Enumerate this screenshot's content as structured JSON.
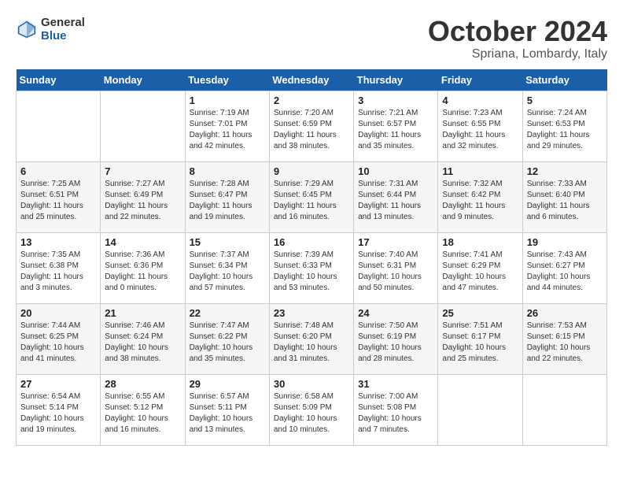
{
  "header": {
    "logo_general": "General",
    "logo_blue": "Blue",
    "month": "October 2024",
    "location": "Spriana, Lombardy, Italy"
  },
  "weekdays": [
    "Sunday",
    "Monday",
    "Tuesday",
    "Wednesday",
    "Thursday",
    "Friday",
    "Saturday"
  ],
  "weeks": [
    [
      {
        "day": "",
        "detail": ""
      },
      {
        "day": "",
        "detail": ""
      },
      {
        "day": "1",
        "detail": "Sunrise: 7:19 AM\nSunset: 7:01 PM\nDaylight: 11 hours and 42 minutes."
      },
      {
        "day": "2",
        "detail": "Sunrise: 7:20 AM\nSunset: 6:59 PM\nDaylight: 11 hours and 38 minutes."
      },
      {
        "day": "3",
        "detail": "Sunrise: 7:21 AM\nSunset: 6:57 PM\nDaylight: 11 hours and 35 minutes."
      },
      {
        "day": "4",
        "detail": "Sunrise: 7:23 AM\nSunset: 6:55 PM\nDaylight: 11 hours and 32 minutes."
      },
      {
        "day": "5",
        "detail": "Sunrise: 7:24 AM\nSunset: 6:53 PM\nDaylight: 11 hours and 29 minutes."
      }
    ],
    [
      {
        "day": "6",
        "detail": "Sunrise: 7:25 AM\nSunset: 6:51 PM\nDaylight: 11 hours and 25 minutes."
      },
      {
        "day": "7",
        "detail": "Sunrise: 7:27 AM\nSunset: 6:49 PM\nDaylight: 11 hours and 22 minutes."
      },
      {
        "day": "8",
        "detail": "Sunrise: 7:28 AM\nSunset: 6:47 PM\nDaylight: 11 hours and 19 minutes."
      },
      {
        "day": "9",
        "detail": "Sunrise: 7:29 AM\nSunset: 6:45 PM\nDaylight: 11 hours and 16 minutes."
      },
      {
        "day": "10",
        "detail": "Sunrise: 7:31 AM\nSunset: 6:44 PM\nDaylight: 11 hours and 13 minutes."
      },
      {
        "day": "11",
        "detail": "Sunrise: 7:32 AM\nSunset: 6:42 PM\nDaylight: 11 hours and 9 minutes."
      },
      {
        "day": "12",
        "detail": "Sunrise: 7:33 AM\nSunset: 6:40 PM\nDaylight: 11 hours and 6 minutes."
      }
    ],
    [
      {
        "day": "13",
        "detail": "Sunrise: 7:35 AM\nSunset: 6:38 PM\nDaylight: 11 hours and 3 minutes."
      },
      {
        "day": "14",
        "detail": "Sunrise: 7:36 AM\nSunset: 6:36 PM\nDaylight: 11 hours and 0 minutes."
      },
      {
        "day": "15",
        "detail": "Sunrise: 7:37 AM\nSunset: 6:34 PM\nDaylight: 10 hours and 57 minutes."
      },
      {
        "day": "16",
        "detail": "Sunrise: 7:39 AM\nSunset: 6:33 PM\nDaylight: 10 hours and 53 minutes."
      },
      {
        "day": "17",
        "detail": "Sunrise: 7:40 AM\nSunset: 6:31 PM\nDaylight: 10 hours and 50 minutes."
      },
      {
        "day": "18",
        "detail": "Sunrise: 7:41 AM\nSunset: 6:29 PM\nDaylight: 10 hours and 47 minutes."
      },
      {
        "day": "19",
        "detail": "Sunrise: 7:43 AM\nSunset: 6:27 PM\nDaylight: 10 hours and 44 minutes."
      }
    ],
    [
      {
        "day": "20",
        "detail": "Sunrise: 7:44 AM\nSunset: 6:25 PM\nDaylight: 10 hours and 41 minutes."
      },
      {
        "day": "21",
        "detail": "Sunrise: 7:46 AM\nSunset: 6:24 PM\nDaylight: 10 hours and 38 minutes."
      },
      {
        "day": "22",
        "detail": "Sunrise: 7:47 AM\nSunset: 6:22 PM\nDaylight: 10 hours and 35 minutes."
      },
      {
        "day": "23",
        "detail": "Sunrise: 7:48 AM\nSunset: 6:20 PM\nDaylight: 10 hours and 31 minutes."
      },
      {
        "day": "24",
        "detail": "Sunrise: 7:50 AM\nSunset: 6:19 PM\nDaylight: 10 hours and 28 minutes."
      },
      {
        "day": "25",
        "detail": "Sunrise: 7:51 AM\nSunset: 6:17 PM\nDaylight: 10 hours and 25 minutes."
      },
      {
        "day": "26",
        "detail": "Sunrise: 7:53 AM\nSunset: 6:15 PM\nDaylight: 10 hours and 22 minutes."
      }
    ],
    [
      {
        "day": "27",
        "detail": "Sunrise: 6:54 AM\nSunset: 5:14 PM\nDaylight: 10 hours and 19 minutes."
      },
      {
        "day": "28",
        "detail": "Sunrise: 6:55 AM\nSunset: 5:12 PM\nDaylight: 10 hours and 16 minutes."
      },
      {
        "day": "29",
        "detail": "Sunrise: 6:57 AM\nSunset: 5:11 PM\nDaylight: 10 hours and 13 minutes."
      },
      {
        "day": "30",
        "detail": "Sunrise: 6:58 AM\nSunset: 5:09 PM\nDaylight: 10 hours and 10 minutes."
      },
      {
        "day": "31",
        "detail": "Sunrise: 7:00 AM\nSunset: 5:08 PM\nDaylight: 10 hours and 7 minutes."
      },
      {
        "day": "",
        "detail": ""
      },
      {
        "day": "",
        "detail": ""
      }
    ]
  ]
}
